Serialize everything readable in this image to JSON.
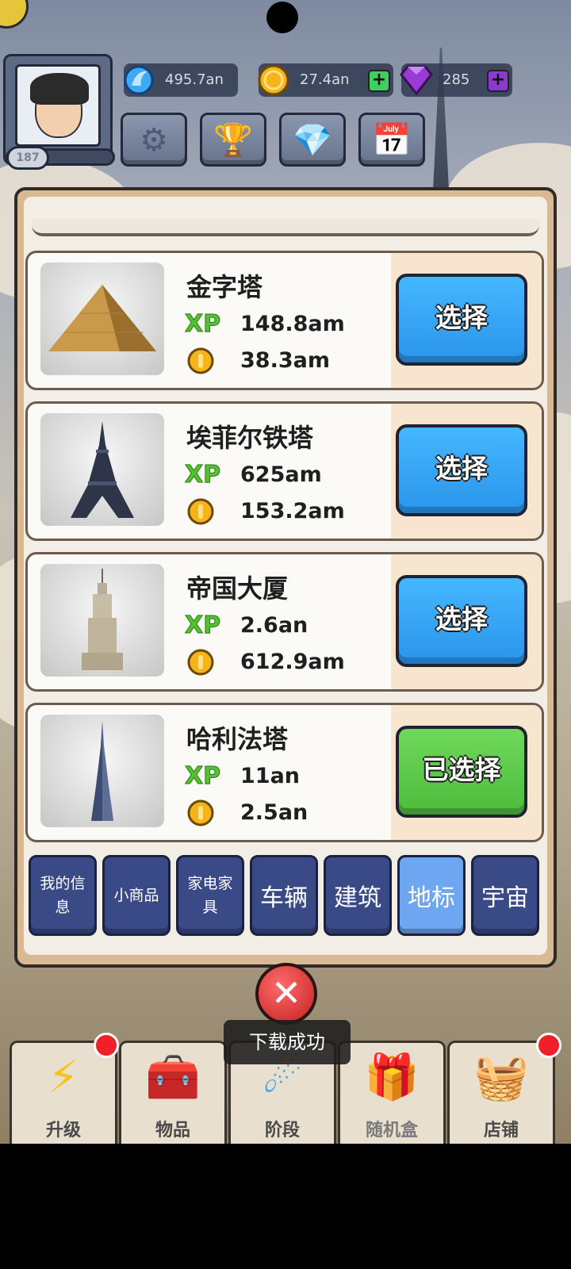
{
  "resources": {
    "energy": {
      "value": "495.7an",
      "icon": "blue-energy-icon"
    },
    "coins": {
      "value": "27.4an",
      "icon": "gold-coin-icon",
      "plus": "+"
    },
    "gems": {
      "value": "285",
      "icon": "purple-gem-icon",
      "plus": "+"
    }
  },
  "profile": {
    "level": "187"
  },
  "hud_buttons": [
    {
      "name": "settings-button",
      "icon": "gear-icon",
      "glyph": "⚙"
    },
    {
      "name": "achievements-button",
      "icon": "trophy-icon",
      "glyph": "🏆"
    },
    {
      "name": "gem-shop-button",
      "icon": "gem-icon",
      "glyph": "💎"
    },
    {
      "name": "calendar-button",
      "icon": "calendar-icon",
      "glyph": "📅"
    }
  ],
  "landmarks": [
    {
      "title": "金字塔",
      "xp_label": "XP",
      "xp": "148.8am",
      "coins": "38.3am",
      "button": "选择",
      "selected": false
    },
    {
      "title": "埃菲尔铁塔",
      "xp_label": "XP",
      "xp": "625am",
      "coins": "153.2am",
      "button": "选择",
      "selected": false
    },
    {
      "title": "帝国大厦",
      "xp_label": "XP",
      "xp": "2.6an",
      "coins": "612.9am",
      "button": "选择",
      "selected": false
    },
    {
      "title": "哈利法塔",
      "xp_label": "XP",
      "xp": "11an",
      "coins": "2.5an",
      "button": "已选择",
      "selected": true
    }
  ],
  "category_tabs": [
    {
      "label": "我的信息",
      "active": false
    },
    {
      "label": "小商品",
      "active": false
    },
    {
      "label": "家电家具",
      "active": false
    },
    {
      "label": "车辆",
      "active": false
    },
    {
      "label": "建筑",
      "active": false
    },
    {
      "label": "地标",
      "active": true
    },
    {
      "label": "宇宙",
      "active": false
    }
  ],
  "close_label": "✕",
  "toast": "下载成功",
  "bottom_nav": [
    {
      "label": "升级",
      "icon": "lightning-icon",
      "glyph": "⚡",
      "badge": true
    },
    {
      "label": "物品",
      "icon": "chest-icon",
      "glyph": "🧰",
      "badge": false
    },
    {
      "label": "阶段",
      "icon": "comet-icon",
      "glyph": "☄",
      "badge": false
    },
    {
      "label": "随机盒",
      "icon": "treasure-chest-icon",
      "glyph": "🎁",
      "badge": false
    },
    {
      "label": "店铺",
      "icon": "basket-icon",
      "glyph": "🧺",
      "badge": true
    }
  ],
  "colors": {
    "select_blue": "#2a94ea",
    "selected_green": "#4dbb3c",
    "tab_active": "#6ea6f2",
    "tab_inactive": "#3a4a86",
    "xp_green": "#53c22e"
  }
}
